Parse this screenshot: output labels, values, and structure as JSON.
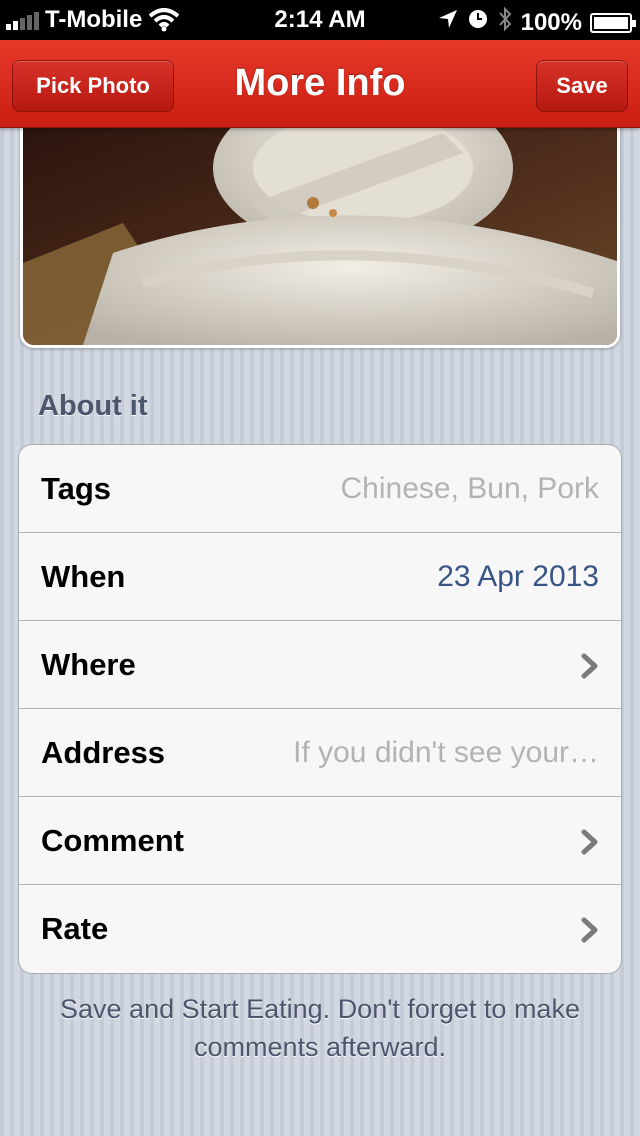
{
  "status_bar": {
    "carrier": "T-Mobile",
    "time": "2:14 AM",
    "battery": "100%"
  },
  "nav": {
    "title": "More Info",
    "left_button": "Pick Photo",
    "right_button": "Save"
  },
  "section": {
    "header": "About it"
  },
  "rows": [
    {
      "label": "Tags",
      "value": "Chinese, Bun, Pork"
    },
    {
      "label": "When",
      "value": "23 Apr 2013"
    },
    {
      "label": "Where",
      "value": ""
    },
    {
      "label": "Address",
      "value": "If you didn't see your…"
    },
    {
      "label": "Comment",
      "value": ""
    },
    {
      "label": "Rate",
      "value": ""
    }
  ],
  "footer": {
    "note": "Save and Start Eating. Don't forget to make comments afterward."
  },
  "colors": {
    "nav_red": "#d7291d",
    "detail_blue": "#385487",
    "placeholder_gray": "#b3b3b3",
    "section_text": "#4c566c"
  },
  "icons": [
    "signal-icon",
    "wifi-icon",
    "location-arrow-icon",
    "alarm-clock-icon",
    "bluetooth-icon",
    "battery-icon",
    "chevron-right-icon"
  ]
}
